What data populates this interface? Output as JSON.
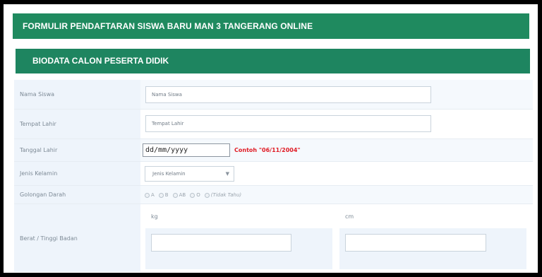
{
  "banner": {
    "title": "FORMULIR PENDAFTARAN SISWA BARU MAN 3 TANGERANG ONLINE"
  },
  "section": {
    "title": "BIODATA CALON PESERTA DIDIK"
  },
  "form": {
    "nama": {
      "label": "Nama Siswa",
      "placeholder": "Nama Siswa"
    },
    "tempat": {
      "label": "Tempat Lahir",
      "placeholder": "Tempat Lahir"
    },
    "tanggal": {
      "label": "Tanggal Lahir",
      "value": "dd/mm/yyyy",
      "hint": "Contoh \"06/11/2004\""
    },
    "jenis": {
      "label": "Jenis Kelamin",
      "selected": "Jenis Kelamin",
      "arrow": "▼"
    },
    "golongan": {
      "label": "Golongan Darah",
      "options": [
        "A",
        "B",
        "AB",
        "O",
        "(Tidak Tahu)"
      ]
    },
    "berat": {
      "label": "Berat / Tinggi Badan",
      "unit_weight": "kg",
      "unit_height": "cm"
    }
  }
}
